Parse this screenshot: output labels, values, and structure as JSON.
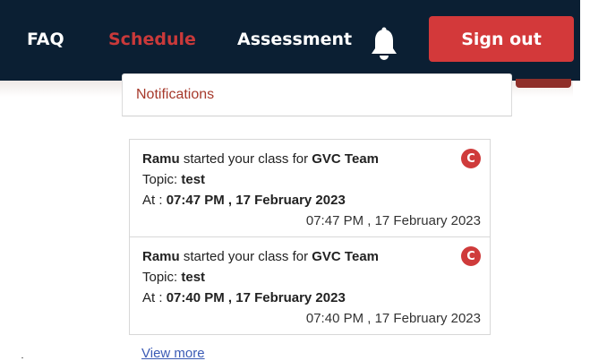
{
  "nav": {
    "faq": "FAQ",
    "schedule": "Schedule",
    "assessment": "Assessment",
    "bell_icon": "bell-icon",
    "sign_out": "Sign out"
  },
  "colors": {
    "navbar_bg": "#0b1f33",
    "accent": "#d3393a",
    "active_link": "#c9393a",
    "notif_title": "#a6392b"
  },
  "notifications": {
    "title": "Notifications",
    "items": [
      {
        "user": "Ramu",
        "action": "started your class for",
        "team": "GVC Team",
        "topic_label": "Topic:",
        "topic": "test",
        "at_label": "At :",
        "at": "07:47 PM , 17 February 2023",
        "timestamp": "07:47 PM , 17 February 2023",
        "badge": "C"
      },
      {
        "user": "Ramu",
        "action": "started your class for",
        "team": "GVC Team",
        "topic_label": "Topic:",
        "topic": "test",
        "at_label": "At :",
        "at": "07:40 PM , 17 February 2023",
        "timestamp": "07:40 PM , 17 February 2023",
        "badge": "C"
      }
    ],
    "view_more": "View more"
  }
}
